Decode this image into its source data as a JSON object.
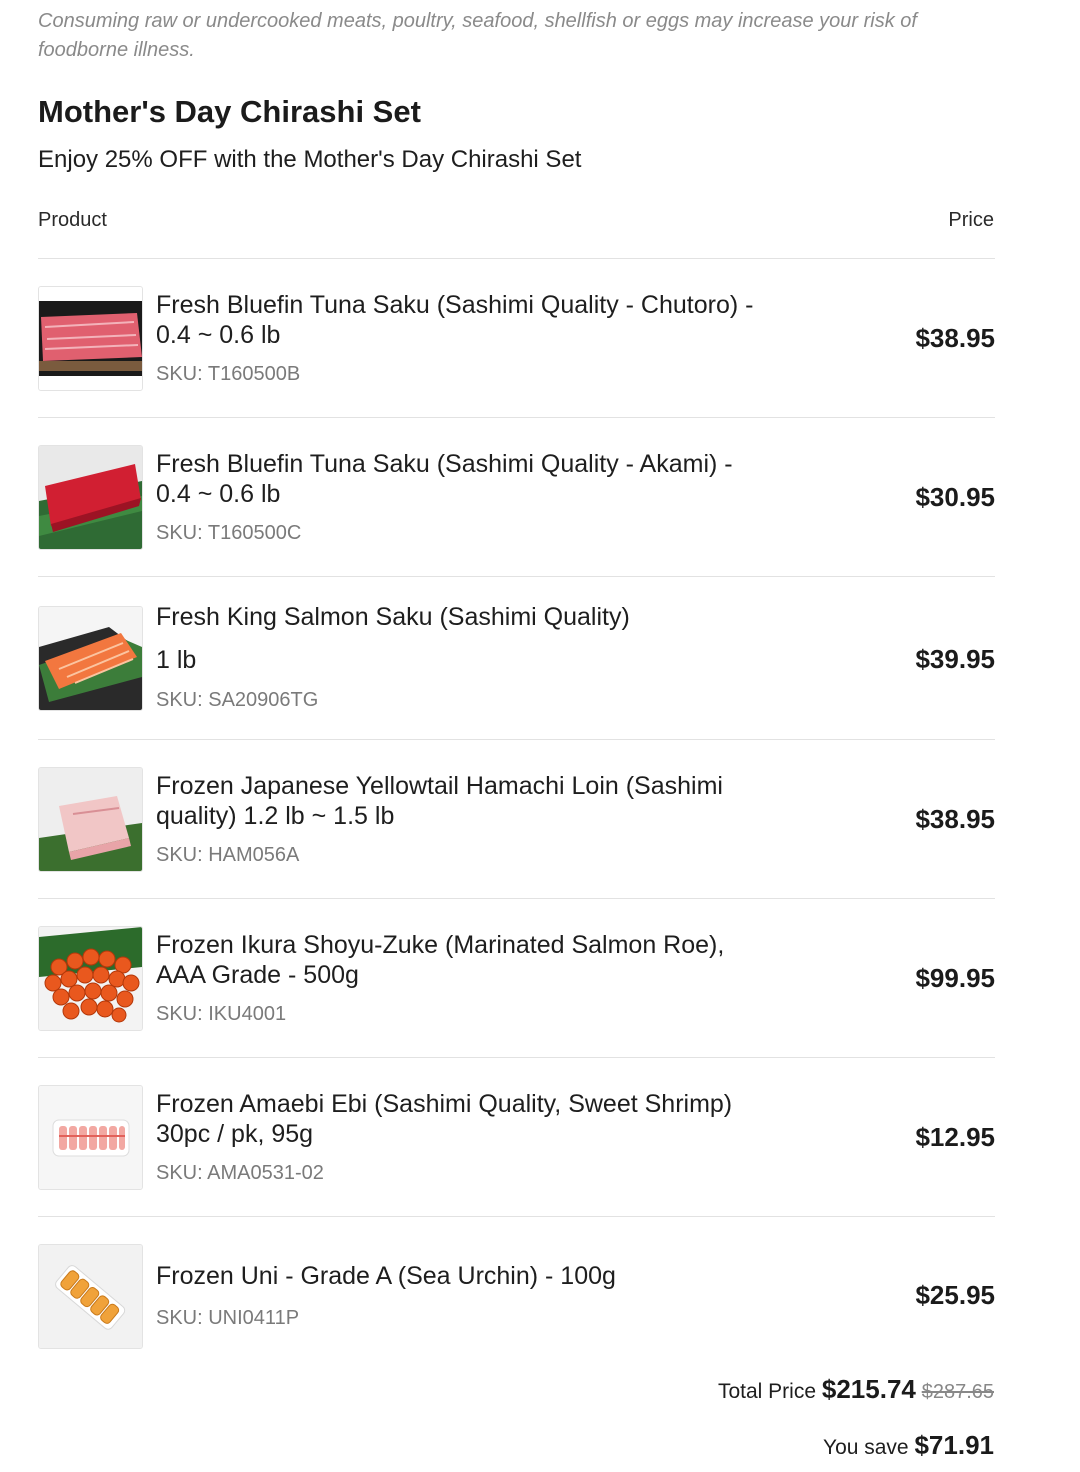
{
  "notice": {
    "disclaimer": "Consuming raw or undercooked meats, poultry, seafood, shellfish or eggs may increase your risk of foodborne illness."
  },
  "bundle": {
    "title": "Mother's Day Chirashi Set",
    "subtitle": "Enjoy 25% OFF with the Mother's Day Chirashi Set"
  },
  "table": {
    "headers": {
      "product": "Product",
      "price": "Price"
    },
    "items": [
      {
        "name_line1": "Fresh Bluefin Tuna Saku (Sashimi Quality - Chutoro) -",
        "name_line2": "0.4 ~ 0.6 lb",
        "sku": "SKU: T160500B",
        "price": "$38.95",
        "image": "chutoro-tuna-image"
      },
      {
        "name_line1": "Fresh Bluefin Tuna Saku (Sashimi Quality - Akami) -",
        "name_line2": "0.4 ~ 0.6 lb",
        "sku": "SKU: T160500C",
        "price": "$30.95",
        "image": "akami-tuna-image"
      },
      {
        "name_line1": "Fresh King Salmon Saku (Sashimi Quality)",
        "name_line2": "1 lb",
        "sku": "SKU: SA20906TG",
        "price": "$39.95",
        "image": "king-salmon-image"
      },
      {
        "name_line1": "Frozen Japanese Yellowtail Hamachi Loin (Sashimi",
        "name_line2": "quality) 1.2 lb ~ 1.5 lb",
        "sku": "SKU: HAM056A",
        "price": "$38.95",
        "image": "hamachi-loin-image"
      },
      {
        "name_line1": "Frozen Ikura Shoyu-Zuke (Marinated Salmon Roe),",
        "name_line2": "AAA Grade - 500g",
        "sku": "SKU: IKU4001",
        "price": "$99.95",
        "image": "ikura-roe-image"
      },
      {
        "name_line1": "Frozen Amaebi Ebi (Sashimi Quality, Sweet Shrimp)",
        "name_line2": "30pc / pk, 95g",
        "sku": "SKU: AMA0531-02",
        "price": "$12.95",
        "image": "amaebi-shrimp-image"
      },
      {
        "name_line1": "Frozen Uni - Grade A (Sea Urchin) - 100g",
        "name_line2": "",
        "sku": "SKU: UNI0411P",
        "price": "$25.95",
        "image": "uni-tray-image"
      }
    ]
  },
  "summary": {
    "total_label": "Total Price",
    "total_price": "$215.74",
    "original_price": "$287.65",
    "save_label": "You save",
    "save_amount": "$71.91"
  }
}
